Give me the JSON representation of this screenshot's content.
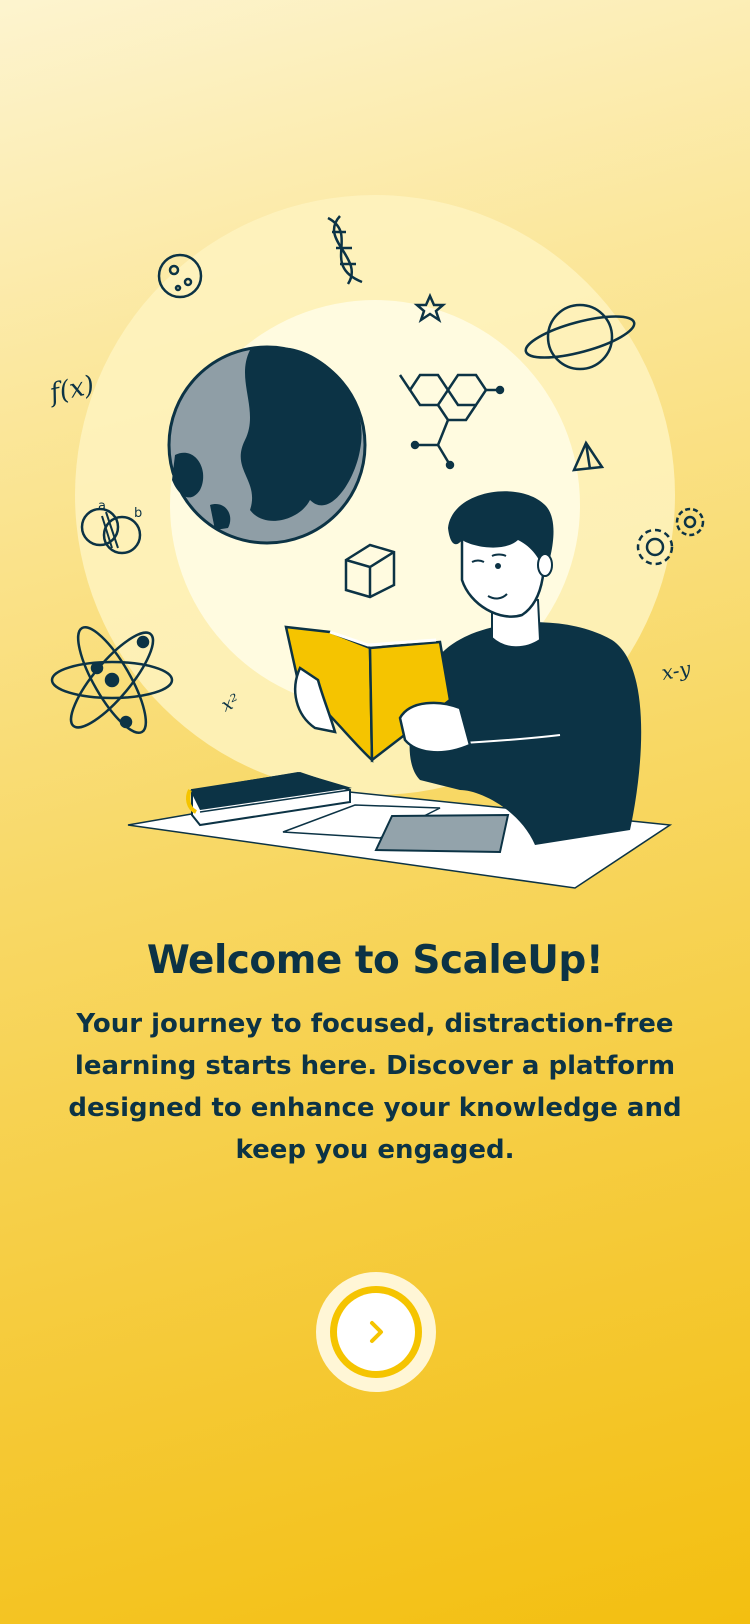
{
  "onboarding": {
    "title": "Welcome to ScaleUp!",
    "description": "Your journey to focused, distraction-free learning starts here. Discover a platform designed to enhance your knowledge and keep you engaged.",
    "next_button_icon": "chevron-right-icon"
  },
  "illustration": {
    "subject": "student-reading-book",
    "labels": {
      "function": "f(x)",
      "equation": "x-y",
      "power": "x²",
      "set_a": "a",
      "set_b": "b"
    }
  },
  "colors": {
    "accent": "#f5c400",
    "text": "#0c3345",
    "background_top": "#fdf4cf",
    "background_bottom": "#f3bf10"
  }
}
